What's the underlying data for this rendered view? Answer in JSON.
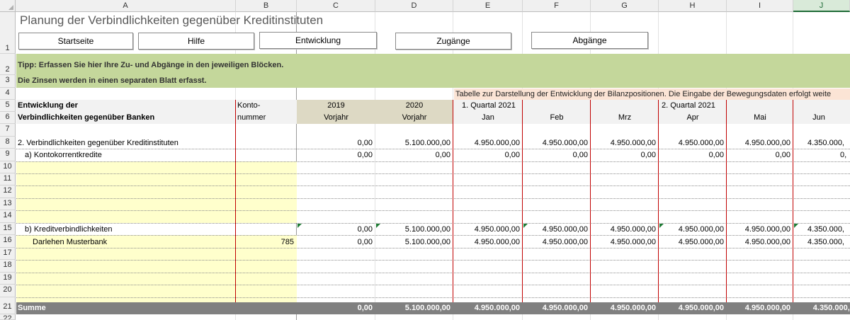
{
  "spreadsheet": {
    "columns": [
      "A",
      "B",
      "C",
      "D",
      "E",
      "F",
      "G",
      "H",
      "I",
      "J"
    ],
    "selected_column": "J",
    "rows": [
      "1",
      "2",
      "3",
      "4",
      "5",
      "6",
      "7",
      "8",
      "9",
      "10",
      "11",
      "12",
      "13",
      "14",
      "15",
      "16",
      "17",
      "18",
      "19",
      "20",
      "21",
      "22"
    ]
  },
  "sheet": {
    "title": "Planung der Verbindlichkeiten gegenüber Kreditinstituten",
    "buttons": {
      "start": "Startseite",
      "help": "Hilfe",
      "development": "Entwicklung",
      "additions": "Zugänge",
      "disposals": "Abgänge"
    },
    "tip": "Tipp:  Erfassen Sie hier Ihre Zu- und Abgänge in den jeweiligen Blöcken.",
    "interest_note": "Die Zinsen werden in einen separaten Blatt erfasst.",
    "banner": "Tabelle zur Darstellung der Entwicklung der Bilanzpositionen. Die Eingabe der Bewegungsdaten erfolgt weite",
    "header": {
      "row5_a": "Entwicklung der",
      "row6_a": "Verbindlichkeiten gegenüber Banken",
      "row5_b": "Konto-",
      "row6_b": "nummer",
      "c_year": "2019",
      "c_label": "Vorjahr",
      "d_year": "2020",
      "d_label": "Vorjahr",
      "q1": "1. Quartal 2021",
      "q2": "2. Quartal 2021",
      "months": [
        "Jan",
        "Feb",
        "Mrz",
        "Apr",
        "Mai",
        "Jun"
      ]
    },
    "data_rows": {
      "r8": {
        "label": "2. Verbindlichkeiten gegenüber Kreditinstituten",
        "account": "",
        "values": [
          "0,00",
          "5.100.000,00",
          "4.950.000,00",
          "4.950.000,00",
          "4.950.000,00",
          "4.950.000,00",
          "4.950.000,00",
          "4.350.000,"
        ]
      },
      "r9": {
        "label": "a) Kontokorrentkredite",
        "account": "",
        "values": [
          "0,00",
          "0,00",
          "0,00",
          "0,00",
          "0,00",
          "0,00",
          "0,00",
          "0,"
        ]
      },
      "r15": {
        "label": "b) Kreditverbindlichkeiten",
        "account": "",
        "values": [
          "0,00",
          "5.100.000,00",
          "4.950.000,00",
          "4.950.000,00",
          "4.950.000,00",
          "4.950.000,00",
          "4.950.000,00",
          "4.350.000,"
        ]
      },
      "r16": {
        "label": "Darlehen Musterbank",
        "account": "785",
        "values": [
          "0,00",
          "5.100.000,00",
          "4.950.000,00",
          "4.950.000,00",
          "4.950.000,00",
          "4.950.000,00",
          "4.950.000,00",
          "4.350.000,"
        ]
      },
      "r21": {
        "label": "Summe",
        "account": "",
        "values": [
          "0,00",
          "5.100.000,00",
          "4.950.000,00",
          "4.950.000,00",
          "4.950.000,00",
          "4.950.000,00",
          "4.950.000,00",
          "4.350.000,00"
        ]
      }
    }
  },
  "colors": {
    "tip_bar": "#c4d79b",
    "banner": "#fbe4d5",
    "input_yellow": "#ffffcc",
    "prior_year_tan": "#ddd9c4",
    "sum_bar": "#808080",
    "separator_red": "#c00000"
  }
}
